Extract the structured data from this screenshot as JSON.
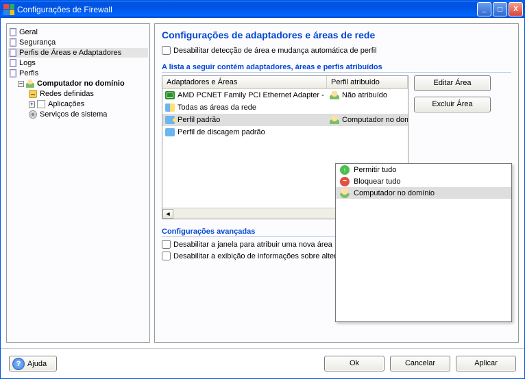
{
  "window": {
    "title": "Configurações de Firewall"
  },
  "sidebar": {
    "items": [
      {
        "label": "Geral"
      },
      {
        "label": "Segurança"
      },
      {
        "label": "Perfis de Áreas e Adaptadores"
      },
      {
        "label": "Logs"
      },
      {
        "label": "Perfis"
      },
      {
        "label": "Computador no domínio"
      },
      {
        "label": "Redes definidas"
      },
      {
        "label": "Aplicações"
      },
      {
        "label": "Serviços de sistema"
      }
    ]
  },
  "main": {
    "heading": "Configurações de adaptadores e áreas de rede",
    "disable_detection": "Desabilitar detecção de área e mudança automática de perfil",
    "list_intro": "A lista a seguir contém adaptadores, áreas e perfis atribuídos",
    "columns": {
      "adapters": "Adaptadores e Áreas",
      "profile": "Perfil atribuído"
    },
    "rows": [
      {
        "a": "AMD PCNET Family PCI Ethernet Adapter - ...",
        "b": "Não atribuído"
      },
      {
        "a": "Todas as áreas da rede",
        "b": ""
      },
      {
        "a": "Perfil padrão",
        "b": "Computador no domínio"
      },
      {
        "a": "Perfil de discagem padrão",
        "b": ""
      }
    ],
    "buttons": {
      "edit": "Editar Área",
      "delete": "Excluir Área"
    },
    "advanced": {
      "title": "Configurações avançadas",
      "opt1": "Desabilitar a janela para atribuir uma nova área",
      "opt2": "Desabilitar a exibição de informações sobre altera"
    }
  },
  "popup": {
    "items": [
      {
        "label": "Permitir tudo"
      },
      {
        "label": "Bloquear tudo"
      },
      {
        "label": "Computador no domínio"
      }
    ]
  },
  "footer": {
    "help": "Ajuda",
    "ok": "Ok",
    "cancel": "Cancelar",
    "apply": "Aplicar"
  }
}
